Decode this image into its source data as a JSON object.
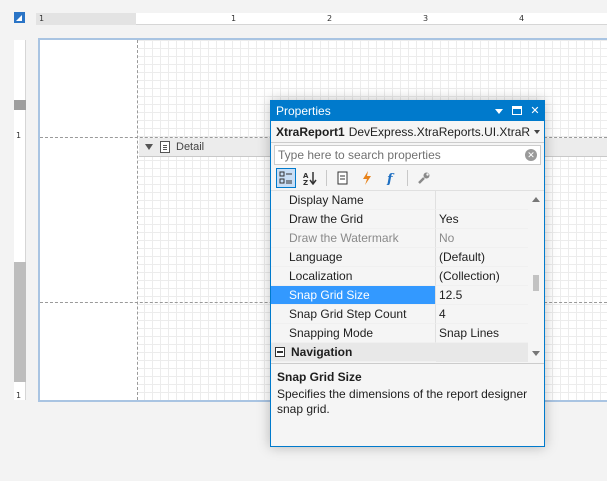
{
  "rulers": {
    "horizontal_labels": [
      "1",
      "1",
      "2",
      "3",
      "4"
    ],
    "vertical_labels": [
      "1",
      "1"
    ]
  },
  "designer": {
    "band_label": "Detail"
  },
  "properties_window": {
    "title": "Properties",
    "object_name": "XtraReport1",
    "object_type": "DevExpress.XtraReports.UI.XtraRep",
    "search_placeholder": "Type here to search properties",
    "rows": [
      {
        "name": "Display Name",
        "value": ""
      },
      {
        "name": "Draw the Grid",
        "value": "Yes"
      },
      {
        "name": "Draw the Watermark",
        "value": "No"
      },
      {
        "name": "Language",
        "value": "(Default)"
      },
      {
        "name": "Localization",
        "value": "(Collection)"
      },
      {
        "name": "Snap Grid Size",
        "value": "12.5"
      },
      {
        "name": "Snap Grid Step Count",
        "value": "4"
      },
      {
        "name": "Snapping Mode",
        "value": "Snap Lines"
      }
    ],
    "category": "Navigation",
    "selected_row": "Snap Grid Size",
    "description": {
      "title": "Snap Grid Size",
      "text": "Specifies the dimensions of the report designer snap grid."
    }
  },
  "colors": {
    "accent": "#007acc",
    "selection": "#3399ff",
    "ruler_corner": "#2a74c6"
  },
  "icons": [
    "categorized-icon",
    "alphabetical-icon",
    "property-pages-icon",
    "events-icon",
    "expressions-icon",
    "wrench-icon"
  ]
}
